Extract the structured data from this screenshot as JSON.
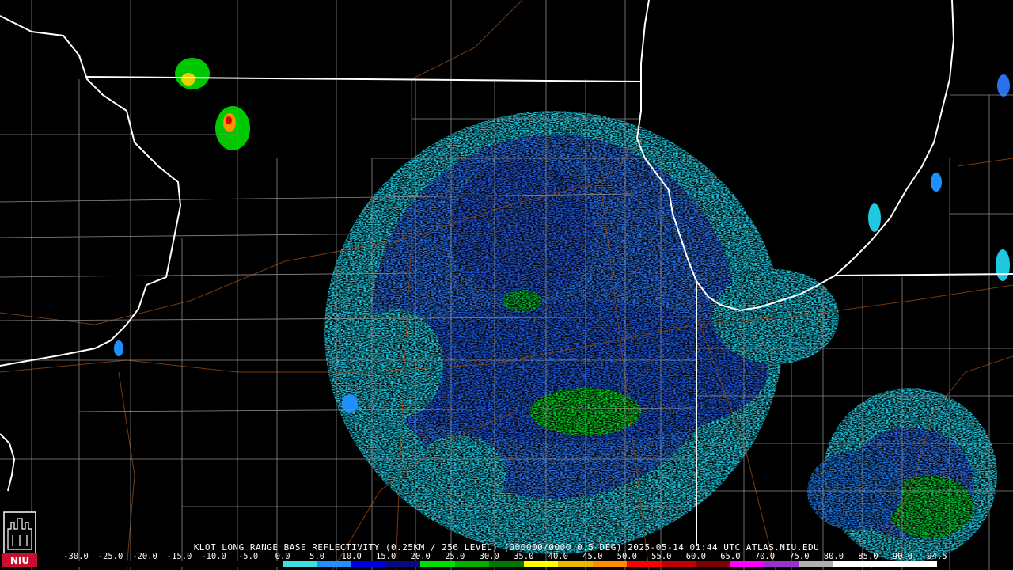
{
  "caption": "KLOT LONG RANGE BASE REFLECTIVITY (0.25KM / 256 LEVEL) (000000/0000 0.5 DEG) 2025-05-14 01:44 UTC  ATLAS.NIU.EDU",
  "logo": {
    "icon": "niu-logo-icon",
    "text": "NIU",
    "colors": {
      "red": "#c8102e",
      "white": "#ffffff"
    }
  },
  "scale": {
    "labels": [
      "-30.0",
      "-25.0",
      "-20.0",
      "-15.0",
      "-10.0",
      "-5.0",
      "0.0",
      "5.0",
      "10.0",
      "15.0",
      "20.0",
      "25.0",
      "30.0",
      "35.0",
      "40.0",
      "45.0",
      "50.0",
      "55.0",
      "60.0",
      "65.0",
      "70.0",
      "75.0",
      "80.0",
      "85.0",
      "90.0",
      "94.5"
    ],
    "colors": [
      "#000000",
      "#000000",
      "#000000",
      "#000000",
      "#000000",
      "#000000",
      "#40e0e0",
      "#1e90ff",
      "#0000e6",
      "#0a0a80",
      "#00e000",
      "#00b000",
      "#007800",
      "#ffff00",
      "#e6b800",
      "#ff8c00",
      "#ff0000",
      "#c00000",
      "#800000",
      "#ff00ff",
      "#9932cc",
      "#b0b0b0",
      "#ffffff",
      "#ffffff",
      "#ffffff"
    ]
  },
  "map": {
    "colors": {
      "state_border": "#ffffff",
      "county_border": "#8a8a8a",
      "roads": "#8b4513",
      "background": "#000000"
    }
  }
}
